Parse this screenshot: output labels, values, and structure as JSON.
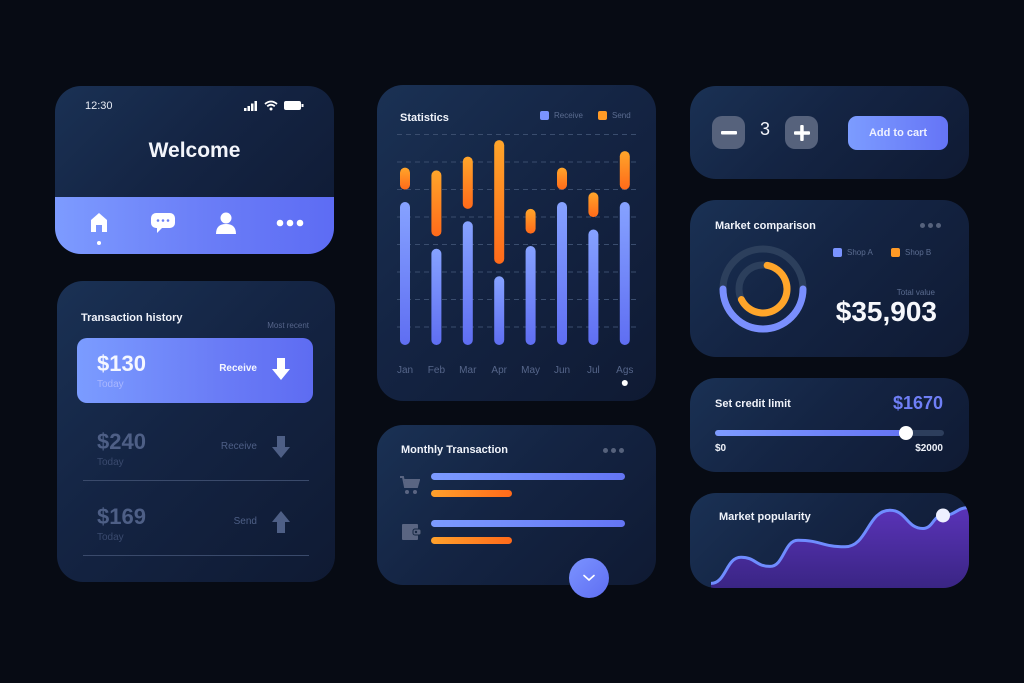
{
  "colors": {
    "background": "#070b14",
    "accent_blue": "#6a7df7",
    "accent_orange": "#ff7a1e",
    "popularity_fill": "#4a2aa0",
    "popularity_line": "#6f8cff"
  },
  "welcome_card": {
    "time": "12:30",
    "status_icons": [
      "signal-icon",
      "wifi-icon",
      "battery-icon"
    ],
    "title": "Welcome",
    "nav": [
      {
        "name": "home",
        "icon": "home-icon",
        "active": true
      },
      {
        "name": "messages",
        "icon": "chat-bubble-icon",
        "active": false
      },
      {
        "name": "profile",
        "icon": "user-icon",
        "active": false
      },
      {
        "name": "more",
        "icon": "more-dots-icon",
        "active": false
      }
    ]
  },
  "transaction_history": {
    "title": "Transaction history",
    "filter": "Most recent",
    "items": [
      {
        "amount": "$130",
        "date": "Today",
        "type": "Receive",
        "direction": "down",
        "active": true
      },
      {
        "amount": "$240",
        "date": "Today",
        "type": "Receive",
        "direction": "down",
        "active": false
      },
      {
        "amount": "$169",
        "date": "Today",
        "type": "Send",
        "direction": "up",
        "active": false
      }
    ]
  },
  "statistics": {
    "title": "Statistics",
    "legend": [
      {
        "label": "Receive",
        "color": "#7a93ff"
      },
      {
        "label": "Send",
        "color": "#ff9a26"
      }
    ],
    "page_indicator": 1
  },
  "chart_data": {
    "type": "bar",
    "title": "Statistics",
    "stacked": true,
    "categories": [
      "Jan",
      "Feb",
      "Mar",
      "Apr",
      "May",
      "Jun",
      "Jul",
      "Ags"
    ],
    "series": [
      {
        "name": "Receive",
        "values": [
          5.2,
          3.5,
          4.5,
          2.5,
          3.6,
          5.2,
          4.2,
          5.2
        ]
      },
      {
        "name": "Send",
        "values": [
          0.8,
          2.4,
          1.9,
          4.5,
          0.9,
          0.8,
          0.9,
          1.4
        ]
      }
    ],
    "gap_between_series": 0.45,
    "ylim": [
      0,
      7.7
    ],
    "grid": true,
    "grid_style": "dashed",
    "legend_position": "top-right",
    "xlabel": "",
    "ylabel": ""
  },
  "monthly_transaction": {
    "title": "Monthly Transaction",
    "rows": [
      {
        "icon": "cart-icon",
        "receive_fraction": 1.0,
        "send_fraction": 0.42
      },
      {
        "icon": "wallet-icon",
        "receive_fraction": 1.0,
        "send_fraction": 0.42
      }
    ]
  },
  "cart": {
    "quantity": "3",
    "decrement_label": "−",
    "increment_label": "+",
    "add_to_cart_label": "Add to cart"
  },
  "market_comparison": {
    "title": "Market comparison",
    "legend": [
      {
        "label": "Shop A",
        "color": "#7a93ff"
      },
      {
        "label": "Shop B",
        "color": "#ff9a26"
      }
    ],
    "shop_a_fraction": 0.5,
    "shop_b_fraction": 0.65,
    "total_label": "Total value",
    "total_value": "$35,903"
  },
  "credit_limit": {
    "title": "Set credit limit",
    "value_label": "$1670",
    "value": 1670,
    "min": 0,
    "max": 2000,
    "min_label": "$0",
    "max_label": "$2000"
  },
  "market_popularity": {
    "title": "Market popularity",
    "series": [
      2,
      22,
      15,
      35,
      30,
      58,
      44,
      54,
      60
    ],
    "highlight_index": 7,
    "ylim": [
      0,
      62
    ]
  }
}
